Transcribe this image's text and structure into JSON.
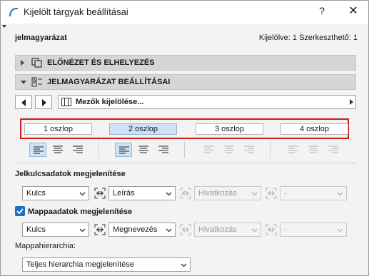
{
  "window": {
    "title": "Kijelölt tárgyak beállításai",
    "help": "?",
    "close": "✕"
  },
  "header": {
    "name": "jelmagyarázat",
    "selection": "Kijelölve: 1 Szerkeszthető: 1"
  },
  "sections": {
    "preview": "ELŐNÉZET ÉS ELHELYEZÉS",
    "legend": "JELMAGYARÁZAT BEÁLLÍTÁSAI"
  },
  "fields_selector": {
    "label": "Mezők kijelölése..."
  },
  "columns": [
    "1 oszlop",
    "2 oszlop",
    "3 oszlop",
    "4 oszlop"
  ],
  "active_column": "2 oszlop",
  "key_display": {
    "label": "Jelkulcsadatok megjelenítése",
    "dd1": "Kulcs",
    "dd2": "Leírás",
    "dd3": "Hivatkozás",
    "dd4": "-"
  },
  "folder_display": {
    "label": "Mappaadatok megjelenítése",
    "checked": true,
    "dd1": "Kulcs",
    "dd2": "Megnevezés",
    "dd3": "Hivatkozás",
    "dd4": "-"
  },
  "hierarchy": {
    "label": "Mappahierarchia:",
    "value": "Teljes hierarchia megjelenítése"
  },
  "colors": {
    "accent": "#1f6fbf",
    "highlight": "#cde2f6",
    "red_box": "#d11a1a"
  }
}
